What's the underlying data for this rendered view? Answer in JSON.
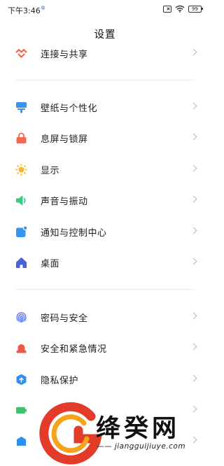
{
  "status_bar": {
    "time": "下午3:46",
    "battery": "99",
    "icons": [
      "gear-icon",
      "sim-x-icon",
      "wifi-icon",
      "battery-icon"
    ]
  },
  "title": "设置",
  "colors": {
    "share": "#f0664f",
    "wallpaper": "#3a93ee",
    "lock": "#f06b4f",
    "display": "#f7b52c",
    "sound": "#41c882",
    "notification": "#3596ef",
    "home": "#4b60d6",
    "password": "#5a72e8",
    "emergency": "#ee5a45",
    "privacy": "#2f8fef",
    "battery": "#3bc46b"
  },
  "sections": [
    {
      "items": [
        {
          "label": "连接与共享",
          "icon": "share-icon"
        }
      ]
    },
    {
      "items": [
        {
          "label": "壁纸与个性化",
          "icon": "wallpaper-icon"
        },
        {
          "label": "息屏与锁屏",
          "icon": "lock-icon"
        },
        {
          "label": "显示",
          "icon": "sun-icon"
        },
        {
          "label": "声音与振动",
          "icon": "speaker-icon"
        },
        {
          "label": "通知与控制中心",
          "icon": "notification-icon"
        },
        {
          "label": "桌面",
          "icon": "home-icon"
        }
      ]
    },
    {
      "items": [
        {
          "label": "密码与安全",
          "icon": "fingerprint-icon"
        },
        {
          "label": "安全和紧急情况",
          "icon": "emergency-icon"
        },
        {
          "label": "隐私保护",
          "icon": "privacy-icon"
        },
        {
          "label": "",
          "icon": "battery-icon"
        },
        {
          "label": "",
          "icon": "app-icon"
        }
      ]
    }
  ],
  "watermark": {
    "name": "绛癸网",
    "url": "—— jiangguijiuye.com"
  }
}
